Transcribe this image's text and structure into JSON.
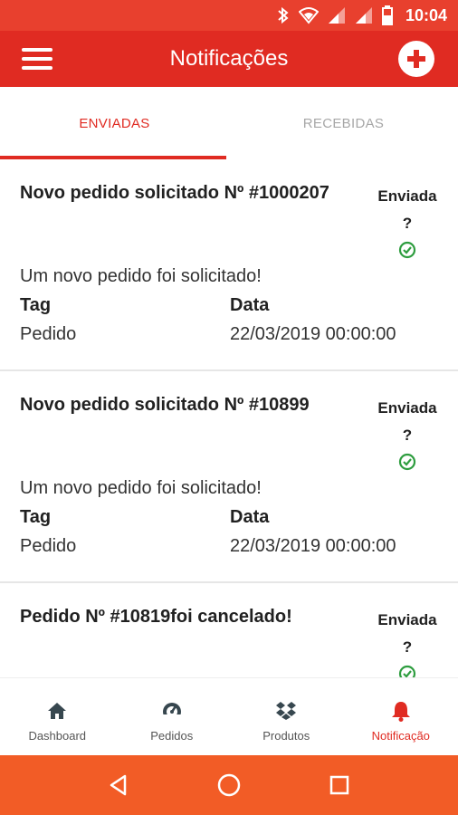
{
  "status_bar": {
    "time": "10:04",
    "icons": [
      "bluetooth-icon",
      "wifi-icon",
      "signal-icon",
      "signal-icon",
      "battery-icon"
    ]
  },
  "colors": {
    "status_bar": "#e8402e",
    "app_bar": "#e02b22",
    "accent": "#e02b22",
    "success": "#2e9d3f",
    "system_nav": "#f25c26"
  },
  "header": {
    "title": "Notificações",
    "menu_icon": "hamburger-menu-icon",
    "add_icon": "add-circle-icon"
  },
  "tabs": [
    {
      "label": "ENVIADAS",
      "active": true
    },
    {
      "label": "RECEBIDAS",
      "active": false
    }
  ],
  "notifications": [
    {
      "title": "Novo pedido solicitado Nº #1000207",
      "status": "Enviada",
      "status_q": "?",
      "message": "Um novo pedido foi solicitado!",
      "tag_label": "Tag",
      "date_label": "Data",
      "tag": "Pedido",
      "date": "22/03/2019 00:00:00"
    },
    {
      "title": "Novo pedido solicitado Nº #10899",
      "status": "Enviada",
      "status_q": "?",
      "message": "Um novo pedido foi solicitado!",
      "tag_label": "Tag",
      "date_label": "Data",
      "tag": "Pedido",
      "date": "22/03/2019 00:00:00"
    },
    {
      "title": "Pedido Nº #10819foi cancelado!",
      "status": "Enviada",
      "status_q": "?",
      "message": "",
      "tag_label": "",
      "date_label": "",
      "tag": "",
      "date": ""
    }
  ],
  "bottom_nav": [
    {
      "label": "Dashboard",
      "icon": "home-icon",
      "active": false
    },
    {
      "label": "Pedidos",
      "icon": "speedometer-icon",
      "active": false
    },
    {
      "label": "Produtos",
      "icon": "dropbox-icon",
      "active": false
    },
    {
      "label": "Notificação",
      "icon": "bell-icon",
      "active": true
    }
  ],
  "system_nav": [
    "back-icon",
    "home-circle-icon",
    "recents-icon"
  ]
}
